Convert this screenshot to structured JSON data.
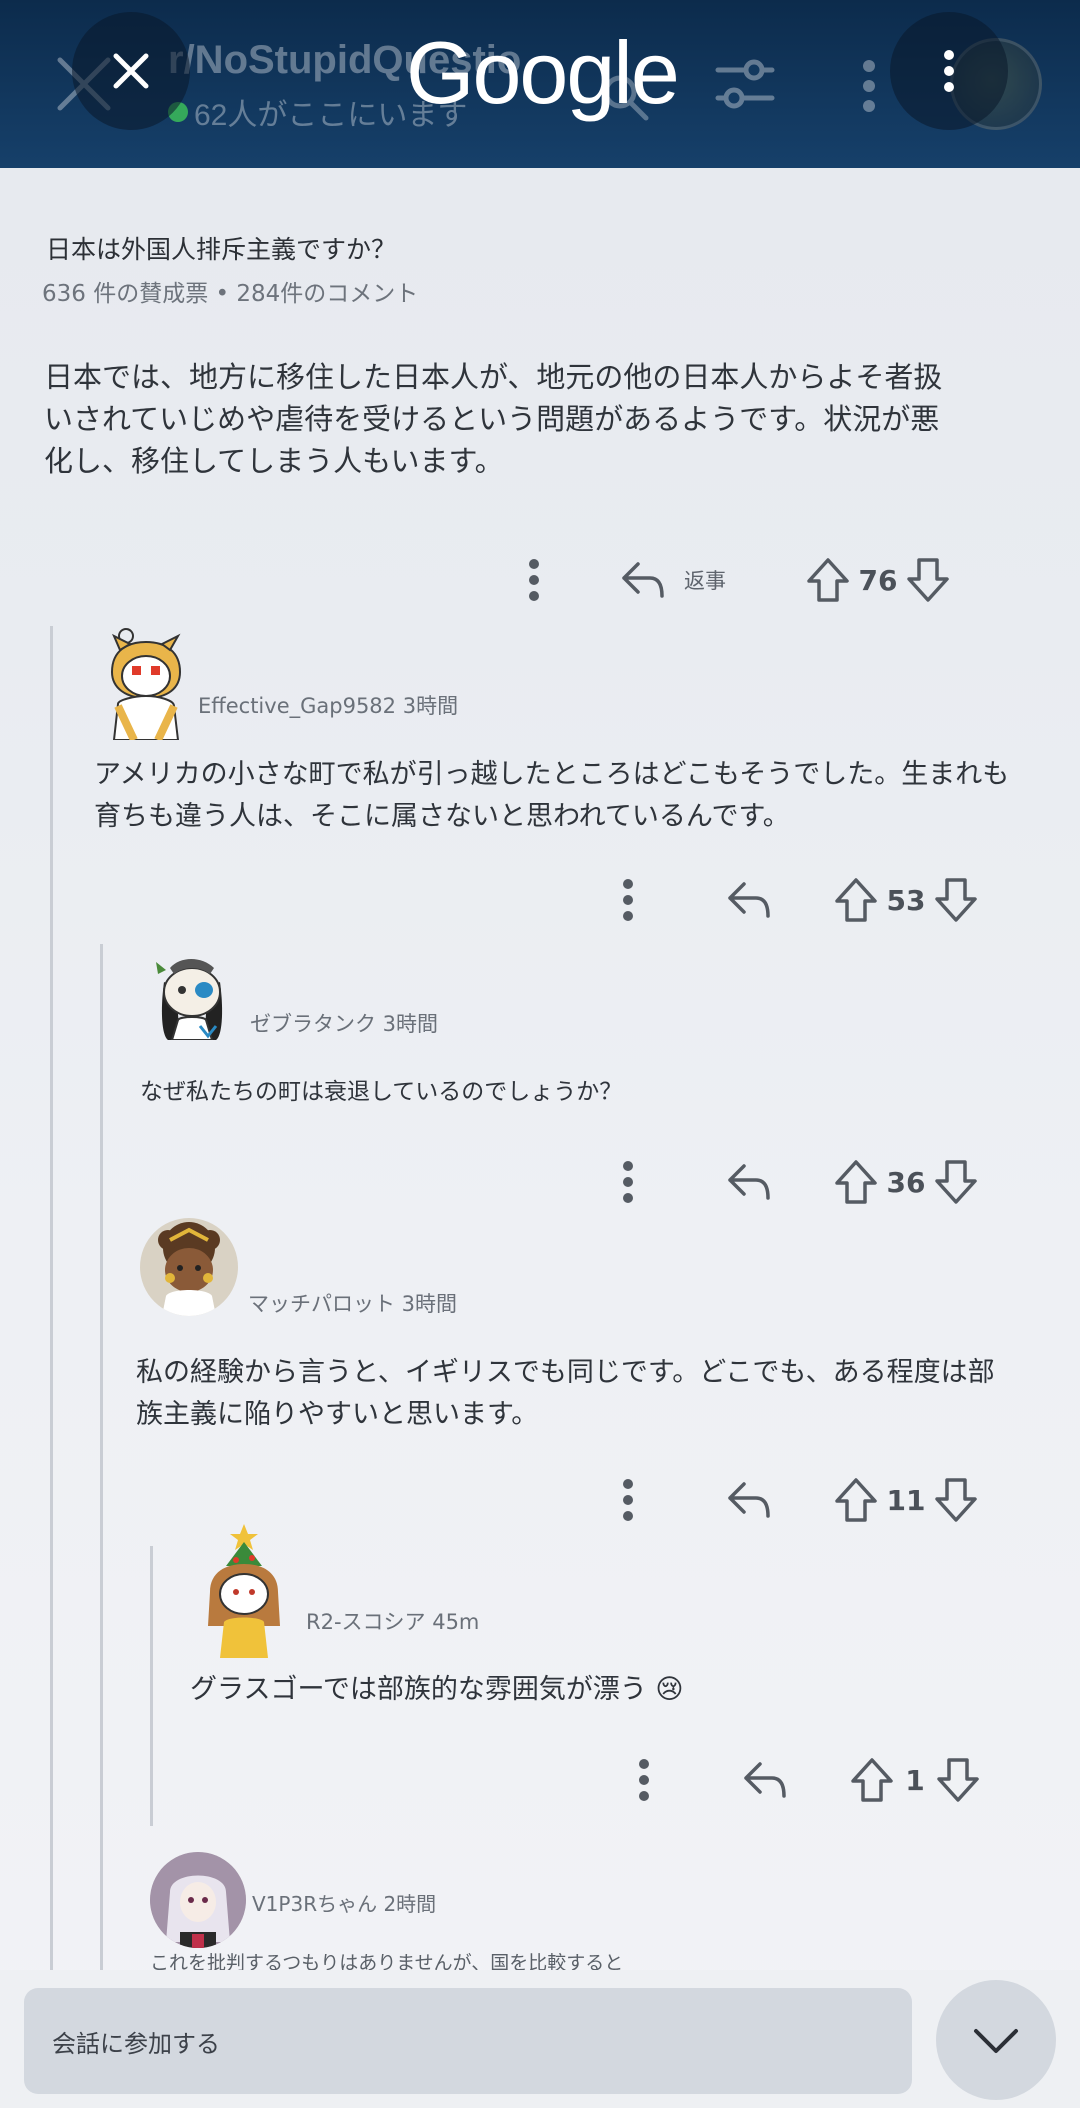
{
  "header": {
    "logo_text": "Google",
    "ghost_subreddit": "r/NoStupidQuestio",
    "ghost_online": "62人がここにいます"
  },
  "post": {
    "title": "日本は外国人排斥主義ですか？",
    "meta": "636 件の賛成票 • 284件のコメント",
    "body": "日本では、地方に移住した日本人が、地元の他の日本人からよそ者扱いされていじめや虐待を受けるという問題があるようです。状況が悪化し、移住してしまう人もいます。",
    "reply_label": "返事",
    "votes": "76"
  },
  "comments": [
    {
      "username_time": "Effective_Gap9582 3時間",
      "text": "アメリカの小さな町で私が引っ越したところはどこもそうでした。生まれも育ちも違う人は、そこに属さないと思われているんです。",
      "votes": "53"
    },
    {
      "username_time": "ゼブラタンク 3時間",
      "text": "なぜ私たちの町は衰退しているのでしょうか？",
      "votes": "36"
    },
    {
      "username_time": "マッチパロット 3時間",
      "text": "私の経験から言うと、イギリスでも同じです。どこでも、ある程度は部族主義に陥りやすいと思います。",
      "votes": "11"
    },
    {
      "username_time": "R2-スコシア 45m",
      "text": "グラスゴーでは部族的な雰囲気が漂う 😢",
      "votes": "1"
    },
    {
      "username_time": "V1P3Rちゃん 2時間",
      "text": "これを批判するつもりはありませんが、国を比較すると"
    }
  ],
  "bottom": {
    "join_placeholder": "会話に参加する"
  },
  "colors": {
    "header_bg": "#0c2b4c",
    "accent_online": "#3ec55a"
  }
}
